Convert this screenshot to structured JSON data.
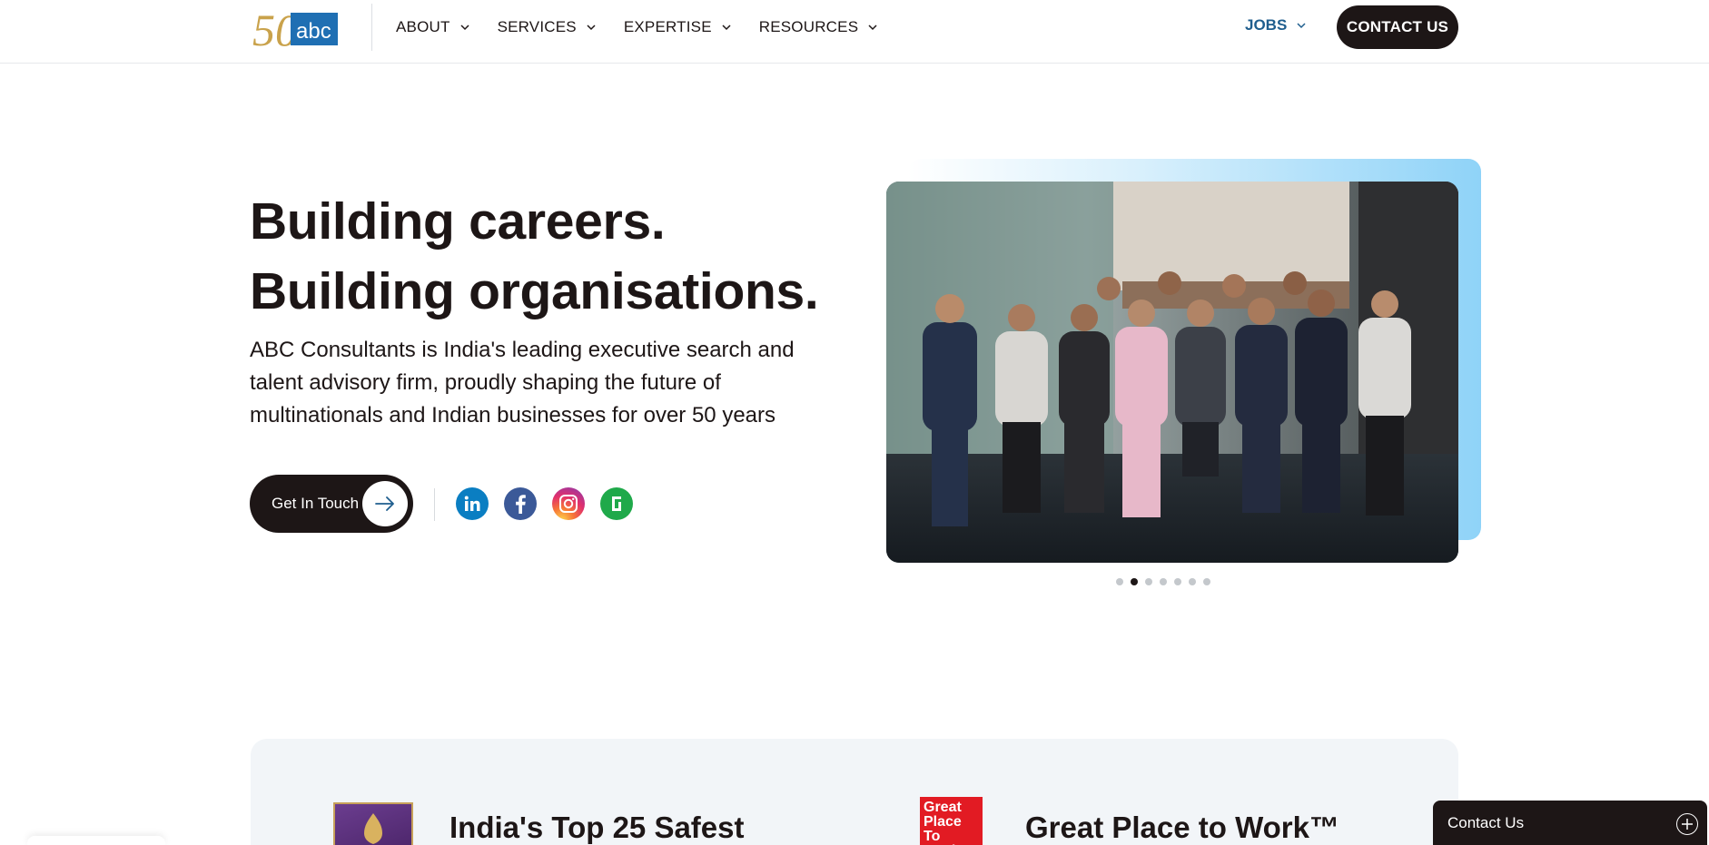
{
  "header": {
    "logo_alt": "abc consultants 50 years",
    "logo_text": "abc",
    "logo_number": "50",
    "nav": [
      {
        "label": "ABOUT"
      },
      {
        "label": "SERVICES"
      },
      {
        "label": "EXPERTISE"
      },
      {
        "label": "RESOURCES"
      }
    ],
    "jobs_label": "JOBS",
    "contact_label": "CONTACT US"
  },
  "hero": {
    "title_line1": "Building careers.",
    "title_line2": "Building organisations.",
    "description": "ABC Consultants is India's leading executive search and talent advisory firm, proudly shaping the future of multinationals and Indian businesses for over 50 years",
    "cta_label": "Get In Touch",
    "social": [
      "linkedin-icon",
      "facebook-icon",
      "instagram-icon",
      "glassdoor-icon"
    ],
    "carousel_total": 7,
    "carousel_active": 2
  },
  "awards": [
    {
      "title": "India's Top 25 Safest"
    },
    {
      "title": "Great Place to Work™",
      "badge": "Great Place To Work"
    }
  ],
  "float_contact": {
    "label": "Contact Us"
  },
  "colors": {
    "dark": "#1d1616",
    "jobs": "#1f5e8e",
    "linkedin": "#0a7ec2",
    "facebook": "#3b5998",
    "glassdoor": "#1fa94a",
    "gptw": "#e21b23"
  }
}
